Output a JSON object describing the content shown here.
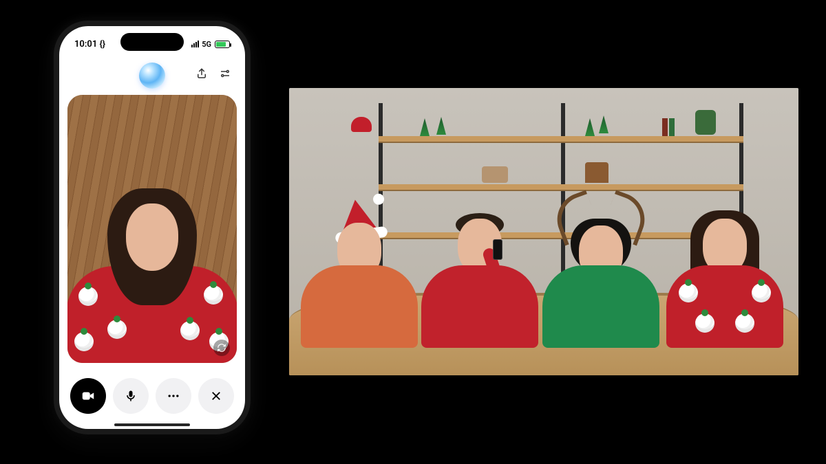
{
  "status_bar": {
    "time": "10:01 {}",
    "network_label": "5G"
  },
  "header": {
    "share_icon": "share-icon",
    "settings_icon": "sliders-icon",
    "avatar": "assistant-orb"
  },
  "controls": {
    "video": "video-icon",
    "mic": "microphone-icon",
    "more": "ellipsis-icon",
    "close": "close-icon",
    "flip": "camera-flip-icon"
  },
  "colors": {
    "sweater_red": "#c0202a",
    "sweater_green": "#1f8a4c",
    "sweater_orange": "#d66a3e",
    "wood_accent": "#c79a5f"
  },
  "scene": {
    "phone_subject": "woman-in-red-santa-sweater",
    "panel_people": [
      "person-santa-hat-orange-sweater",
      "person-holding-phone-red-sweater",
      "person-reindeer-antlers-green-sweater",
      "person-long-hair-red-santa-sweater"
    ],
    "panel_setting": "holiday-decorated-shelf-room"
  }
}
